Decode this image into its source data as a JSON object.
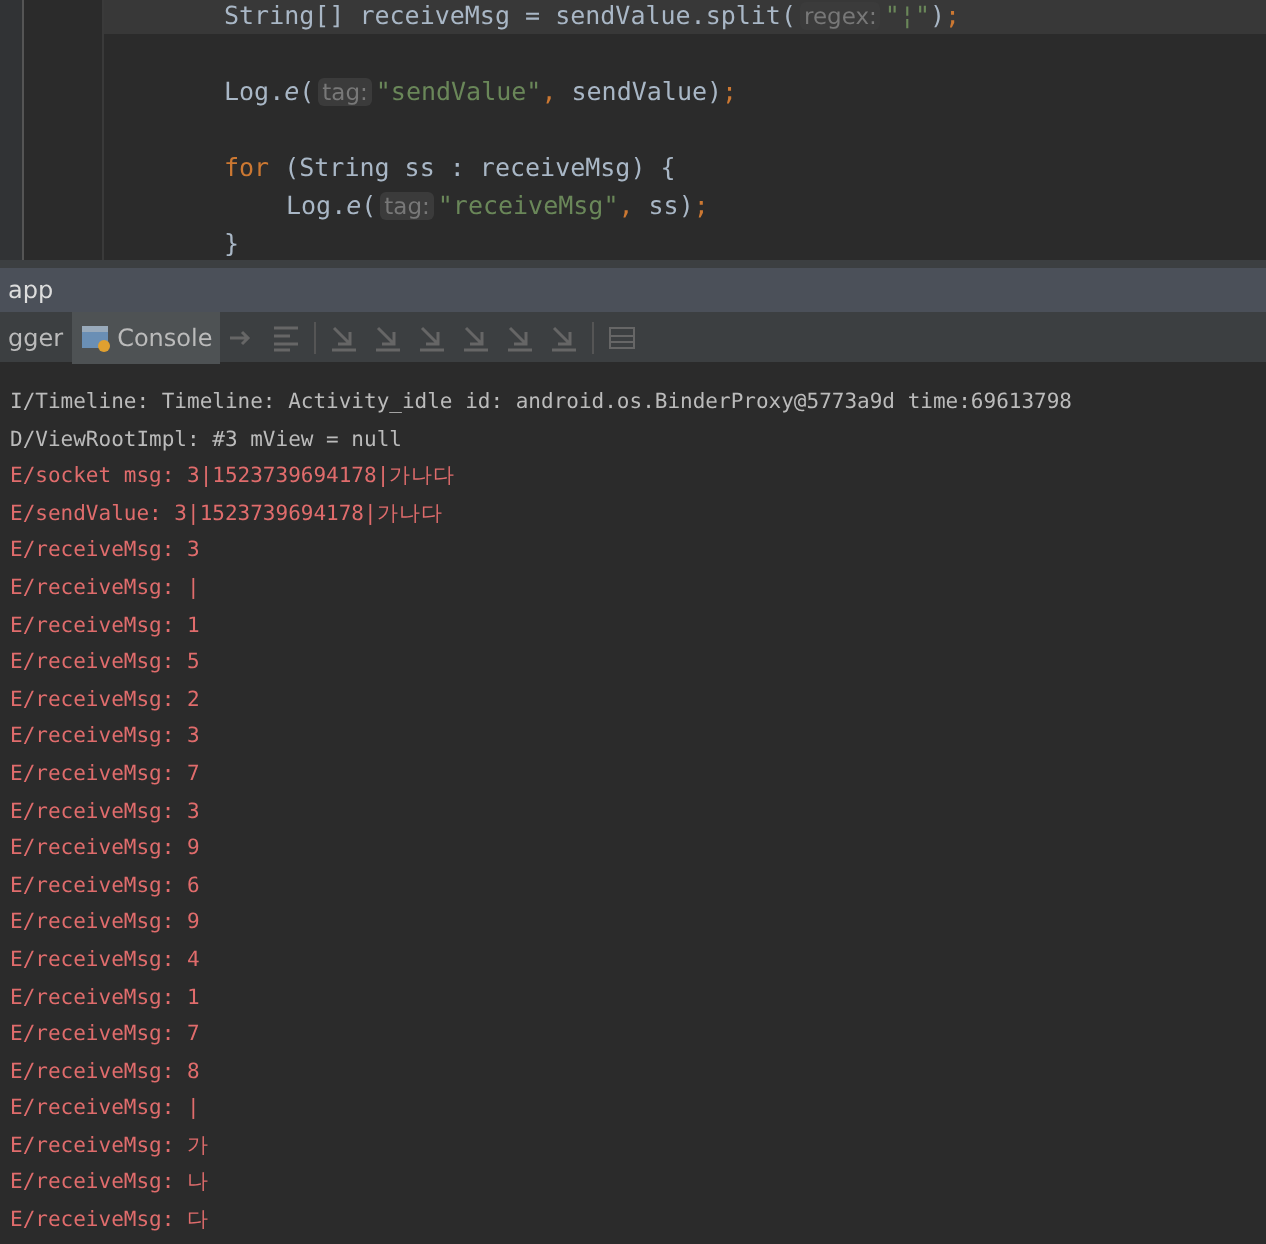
{
  "editor": {
    "lines": [
      {
        "current": true,
        "tokens": [
          {
            "kind": "plain",
            "text": "String[] receiveMsg = sendValue.split("
          },
          {
            "kind": "hint",
            "text": "regex:"
          },
          {
            "kind": "string",
            "text": "\"¦\""
          },
          {
            "kind": "plain",
            "text": ")"
          },
          {
            "kind": "punct",
            "text": ";"
          }
        ]
      },
      {
        "current": false
      },
      {
        "current": false,
        "tokens": [
          {
            "kind": "plain",
            "text": "Log."
          },
          {
            "kind": "method",
            "text": "e"
          },
          {
            "kind": "plain",
            "text": "("
          },
          {
            "kind": "hint",
            "text": "tag:"
          },
          {
            "kind": "string",
            "text": "\"sendValue\""
          },
          {
            "kind": "punct",
            "text": ","
          },
          {
            "kind": "plain",
            "text": " sendValue)"
          },
          {
            "kind": "punct",
            "text": ";"
          }
        ]
      },
      {
        "current": false
      },
      {
        "current": false,
        "tokens": [
          {
            "kind": "keyword",
            "text": "for"
          },
          {
            "kind": "plain",
            "text": " (String ss : receiveMsg) {"
          }
        ]
      },
      {
        "current": false,
        "indent": true,
        "tokens": [
          {
            "kind": "plain",
            "text": "Log."
          },
          {
            "kind": "method",
            "text": "e"
          },
          {
            "kind": "plain",
            "text": "("
          },
          {
            "kind": "hint",
            "text": "tag:"
          },
          {
            "kind": "string",
            "text": "\"receiveMsg\""
          },
          {
            "kind": "punct",
            "text": ","
          },
          {
            "kind": "plain",
            "text": " ss)"
          },
          {
            "kind": "punct",
            "text": ";"
          }
        ]
      },
      {
        "current": false,
        "tokens": [
          {
            "kind": "plain",
            "text": "}"
          }
        ]
      }
    ]
  },
  "tool_window": {
    "title": "app",
    "tabs": [
      {
        "label": "gger",
        "selected": false
      },
      {
        "label": "Console",
        "selected": true
      }
    ],
    "log": [
      {
        "kind": "info",
        "text": "I/Timeline: Timeline: Activity_idle id: android.os.BinderProxy@5773a9d time:69613798"
      },
      {
        "kind": "debug",
        "text": "D/ViewRootImpl: #3 mView = null"
      },
      {
        "kind": "error",
        "text": "E/socket msg: 3|1523739694178|가나다"
      },
      {
        "kind": "error",
        "text": "E/sendValue: 3|1523739694178|가나다"
      },
      {
        "kind": "error",
        "text": "E/receiveMsg: 3"
      },
      {
        "kind": "error",
        "text": "E/receiveMsg: |"
      },
      {
        "kind": "error",
        "text": "E/receiveMsg: 1"
      },
      {
        "kind": "error",
        "text": "E/receiveMsg: 5"
      },
      {
        "kind": "error",
        "text": "E/receiveMsg: 2"
      },
      {
        "kind": "error",
        "text": "E/receiveMsg: 3"
      },
      {
        "kind": "error",
        "text": "E/receiveMsg: 7"
      },
      {
        "kind": "error",
        "text": "E/receiveMsg: 3"
      },
      {
        "kind": "error",
        "text": "E/receiveMsg: 9"
      },
      {
        "kind": "error",
        "text": "E/receiveMsg: 6"
      },
      {
        "kind": "error",
        "text": "E/receiveMsg: 9"
      },
      {
        "kind": "error",
        "text": "E/receiveMsg: 4"
      },
      {
        "kind": "error",
        "text": "E/receiveMsg: 1"
      },
      {
        "kind": "error",
        "text": "E/receiveMsg: 7"
      },
      {
        "kind": "error",
        "text": "E/receiveMsg: 8"
      },
      {
        "kind": "error",
        "text": "E/receiveMsg: |"
      },
      {
        "kind": "error",
        "text": "E/receiveMsg: 가"
      },
      {
        "kind": "error",
        "text": "E/receiveMsg: 나"
      },
      {
        "kind": "error",
        "text": "E/receiveMsg: 다"
      }
    ]
  }
}
